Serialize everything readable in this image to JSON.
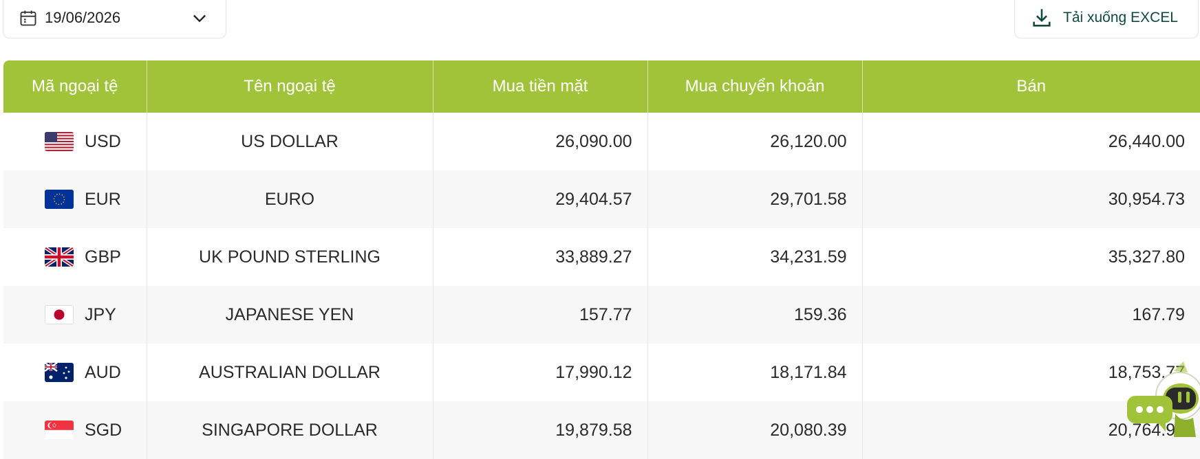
{
  "date_picker": {
    "value": "19/06/2026"
  },
  "download": {
    "label": "Tải xuống EXCEL"
  },
  "table": {
    "headers": [
      "Mã ngoại tệ",
      "Tên ngoại tệ",
      "Mua tiền mặt",
      "Mua chuyển khoản",
      "Bán"
    ],
    "rows": [
      {
        "code": "USD",
        "name": "US DOLLAR",
        "cash_buy": "26,090.00",
        "transfer_buy": "26,120.00",
        "sell": "26,440.00"
      },
      {
        "code": "EUR",
        "name": "EURO",
        "cash_buy": "29,404.57",
        "transfer_buy": "29,701.58",
        "sell": "30,954.73"
      },
      {
        "code": "GBP",
        "name": "UK POUND STERLING",
        "cash_buy": "33,889.27",
        "transfer_buy": "34,231.59",
        "sell": "35,327.80"
      },
      {
        "code": "JPY",
        "name": "JAPANESE YEN",
        "cash_buy": "157.77",
        "transfer_buy": "159.36",
        "sell": "167.79"
      },
      {
        "code": "AUD",
        "name": "AUSTRALIAN DOLLAR",
        "cash_buy": "17,990.12",
        "transfer_buy": "18,171.84",
        "sell": "18,753.77"
      },
      {
        "code": "SGD",
        "name": "SINGAPORE DOLLAR",
        "cash_buy": "19,879.58",
        "transfer_buy": "20,080.39",
        "sell": "20,764.93"
      }
    ]
  },
  "colors": {
    "header_bg": "#a1c33a",
    "header_text": "#ffffff",
    "accent_dark": "#0f4a3c"
  },
  "icons": {
    "date_picker": "calendar-icon",
    "dropdown": "chevron-down-icon",
    "download": "download-icon",
    "chat": "chatbot-icon"
  }
}
